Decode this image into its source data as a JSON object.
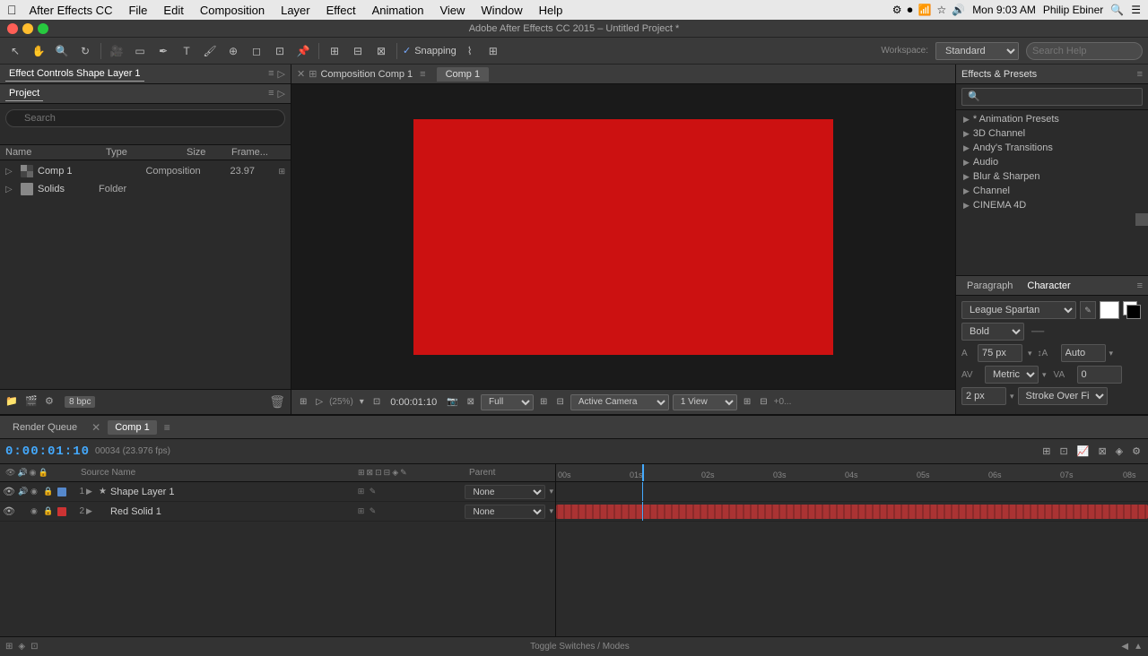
{
  "menubar": {
    "apple": "&#xF8FF;",
    "items": [
      "After Effects CC",
      "File",
      "Edit",
      "Composition",
      "Layer",
      "Effect",
      "Animation",
      "View",
      "Window",
      "Help"
    ],
    "right": {
      "time": "Mon 9:03 AM",
      "user": "Philip Ebiner"
    }
  },
  "toolbar": {
    "snapping_label": "Snapping",
    "workspace_label": "Standard",
    "search_placeholder": "Search Help"
  },
  "left_panel": {
    "tabs": [
      "Effect Controls Shape Layer 1",
      "Project"
    ],
    "search_placeholder": "Search",
    "columns": {
      "name": "Name",
      "type": "Type",
      "size": "Size",
      "frame": "Frame..."
    },
    "items": [
      {
        "name": "Comp 1",
        "type": "Composition",
        "size": "23.97",
        "icon": "comp",
        "indent": 0
      },
      {
        "name": "Solids",
        "type": "Folder",
        "size": "",
        "icon": "folder",
        "indent": 0
      }
    ],
    "bpc": "8 bpc"
  },
  "comp_panel": {
    "title": "Composition Comp 1",
    "tab": "Comp 1",
    "timecode": "0:00:01:10",
    "magnification": "(25%)",
    "quality": "Full",
    "camera": "Active Camera",
    "view": "1 View",
    "background": "#cc1111"
  },
  "right_panel": {
    "title": "Effects & Presets",
    "effects": [
      "* Animation Presets",
      "3D Channel",
      "Andy's Transitions",
      "Audio",
      "Blur & Sharpen",
      "Channel",
      "CINEMA 4D"
    ]
  },
  "character_panel": {
    "tabs": [
      "Paragraph",
      "Character"
    ],
    "font": "League Spartan",
    "style": "Bold",
    "size": "75 px",
    "tracking_label": "Auto",
    "tracking_value": "0",
    "kerning_label": "Metrics",
    "stroke_size": "2 px",
    "stroke_type": "Stroke Over Fill"
  },
  "timeline": {
    "tabs": [
      "Render Queue",
      "Comp 1"
    ],
    "timecode": "0:00:01:10",
    "fps": "00034 (23.976 fps)",
    "layers": [
      {
        "num": "1",
        "name": "Shape Layer 1",
        "color": "#5588cc",
        "source": "",
        "parent": "None"
      },
      {
        "num": "2",
        "name": "Red Solid 1",
        "color": "#cc3333",
        "source": "",
        "parent": "None"
      }
    ],
    "time_marks": [
      "00s",
      "01s",
      "02s",
      "03s",
      "04s",
      "05s",
      "06s",
      "07s",
      "08s"
    ],
    "playhead_percent": 14.5,
    "bottom_label": "Toggle Switches / Modes"
  }
}
